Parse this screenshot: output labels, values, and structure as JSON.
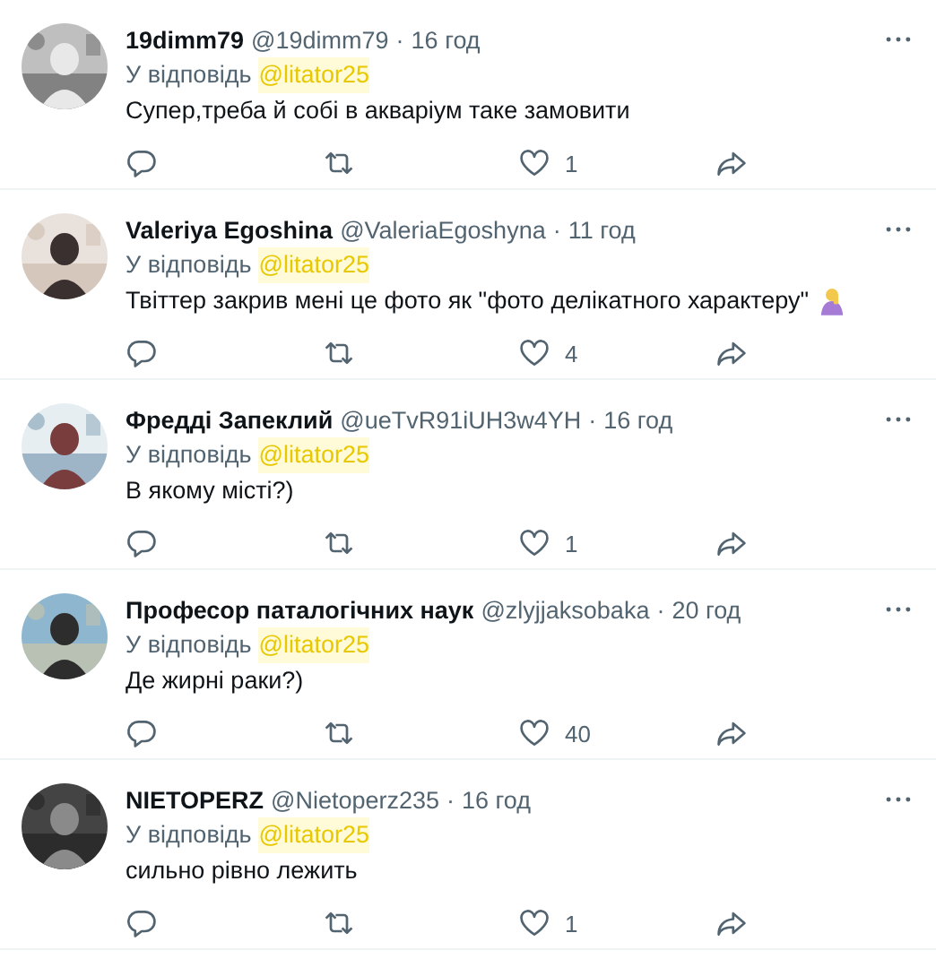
{
  "replies": [
    {
      "name": "19dimm79",
      "handle": "@19dimm79",
      "separator": "·",
      "time": "16 год",
      "reply_label": "У відповідь",
      "mention": "@litator25",
      "text": "Супер,треба й собі в акваріум таке замовити",
      "emoji": false,
      "likes": "1"
    },
    {
      "name": "Valeriya Egoshina",
      "handle": "@ValeriaEgoshyna",
      "separator": "·",
      "time": "11 год",
      "reply_label": "У відповідь",
      "mention": "@litator25",
      "text": "Твіттер закрив мені це фото як \"фото делікатного характеру\"",
      "emoji": true,
      "likes": "4"
    },
    {
      "name": "Фредді Запеклий",
      "handle": "@ueTvR91iUH3w4YH",
      "separator": "·",
      "time": "16 год",
      "reply_label": "У відповідь",
      "mention": "@litator25",
      "text": "В якому місті?)",
      "emoji": false,
      "likes": "1"
    },
    {
      "name": "Професор паталогічних наук",
      "handle": "@zlyjjaksobaka",
      "separator": "·",
      "time": "20 год",
      "reply_label": "У відповідь",
      "mention": "@litator25",
      "text": "Де жирні раки?)",
      "emoji": false,
      "likes": "40"
    },
    {
      "name": "NIETOPERZ",
      "handle": "@Nietoperz235",
      "separator": "·",
      "time": "16 год",
      "reply_label": "У відповідь",
      "mention": "@litator25",
      "text": "сильно рівно лежить",
      "emoji": false,
      "likes": "1"
    }
  ]
}
